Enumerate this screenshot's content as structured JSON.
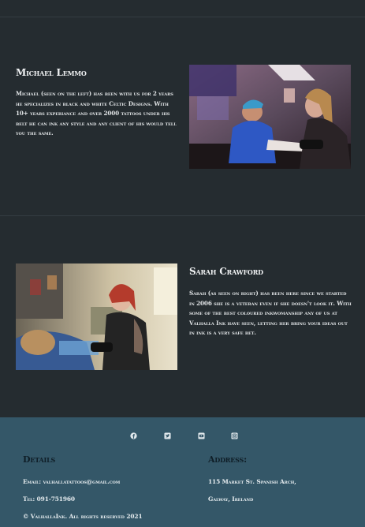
{
  "artists": [
    {
      "name": "Michael Lemmo",
      "bio": "Michael (seen on the left) has been with us for 2 years he specializes in black and white Celtic Designs. With 10+ years experiance and over 2000 tattoos under his belt he can ink any style and any client of his would tell you the same.",
      "photo": "tattoo-studio-photo"
    },
    {
      "name": "Sarah Crawford",
      "bio": "Sarah (as seen on right) has been here since we started in 2006 she is a veteran even if she doesn't look it. With some of the best coloured inkwomanship any of us at Valhalla Ink have seen, letting her bring your ideas out in ink is a very safe bet.",
      "photo": "tattoo-session-photo"
    }
  ],
  "footer": {
    "social": [
      "facebook-icon",
      "twitter-icon",
      "youtube-icon",
      "instagram-icon"
    ],
    "details_heading": "Details",
    "email": "Email: valhallatattoos@gmail.com",
    "phone": "Tel: 091-751960",
    "copyright": "© ValhallaInk. All rights reserved 2021",
    "address_heading": "Address:",
    "address_line1": "115 Market St. Spanish Arch,",
    "address_line2": "Galway, Ireland"
  },
  "colors": {
    "page_bg": "#252c30",
    "footer_bg": "#345768",
    "heading_dark": "#0f1e27",
    "text_light": "#e9ecef"
  }
}
